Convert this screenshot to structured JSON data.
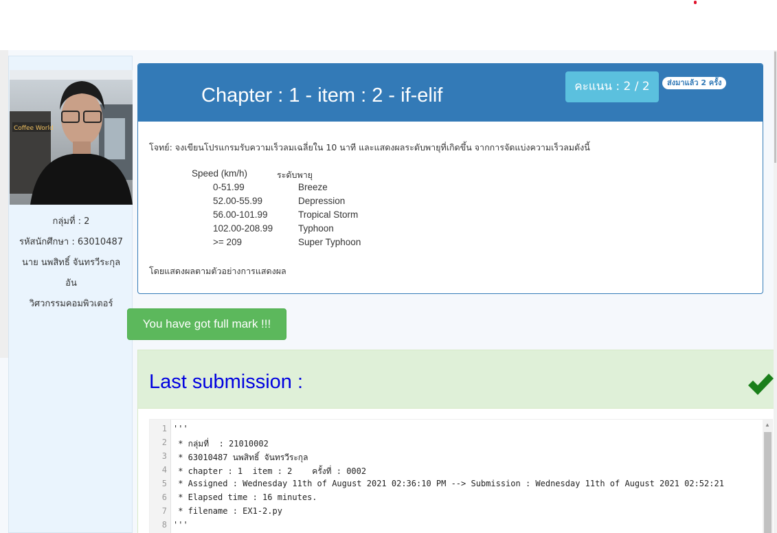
{
  "sidebar": {
    "group": "กลุ่มที่ : 2",
    "student_id": "รหัสนักศึกษา : 63010487",
    "name_line1": "นาย นพสิทธิ์ จันทรวีระกุล",
    "name_line2": "อัน",
    "faculty": "วิศวกรรมคอมพิวเตอร์"
  },
  "question": {
    "title": "Chapter : 1 - item : 2 - if-elif",
    "score_label": "คะแนน : 2 / 2",
    "sent_badge": "ส่งมาแล้ว 2 ครั้ง",
    "prompt": "โจทย์: จงเขียนโปรแกรมรับความเร็วลมเฉลี่ยใน 10 นาที และแสดงผลระดับพายุที่เกิดขึ้น จากการจัดแบ่งความเร็วลมดังนี้",
    "table_header_speed": "Speed (km/h)",
    "table_header_level": "ระดับพายุ",
    "rows": [
      {
        "range": "0-51.99",
        "level": "Breeze"
      },
      {
        "range": "52.00-55.99",
        "level": "Depression"
      },
      {
        "range": "56.00-101.99",
        "level": "Tropical Storm"
      },
      {
        "range": "102.00-208.99",
        "level": "Typhoon"
      },
      {
        "range": ">= 209",
        "level": "Super Typhoon"
      }
    ],
    "footer": "โดยแสดงผลตามตัวอย่างการแสดงผล"
  },
  "fullmark_label": "You have got full mark !!!",
  "submission": {
    "title": "Last submission :",
    "check_icon": "checkmark-icon",
    "code_lines": [
      {
        "n": "1",
        "text": "'''"
      },
      {
        "n": "2",
        "text": " * กลุ่มที่  : 21010002"
      },
      {
        "n": "3",
        "text": " * 63010487 นพสิทธิ์ จันทรวีระกุล"
      },
      {
        "n": "4",
        "text": " * chapter : 1  item : 2    ครั้งที่ : 0002"
      },
      {
        "n": "5",
        "text": " * Assigned : Wednesday 11th of August 2021 02:36:10 PM --> Submission : Wednesday 11th of August 2021 02:52:21"
      },
      {
        "n": "6",
        "text": " * Elapsed time : 16 minutes."
      },
      {
        "n": "7",
        "text": " * filename : EX1-2.py"
      },
      {
        "n": "8",
        "text": "'''"
      }
    ]
  },
  "colors": {
    "primary": "#337ab7",
    "info": "#5bc0de",
    "success": "#5cb85c",
    "success_bg": "#dff0d8",
    "submission_title": "#0000e0",
    "check": "#1a7f1a"
  }
}
